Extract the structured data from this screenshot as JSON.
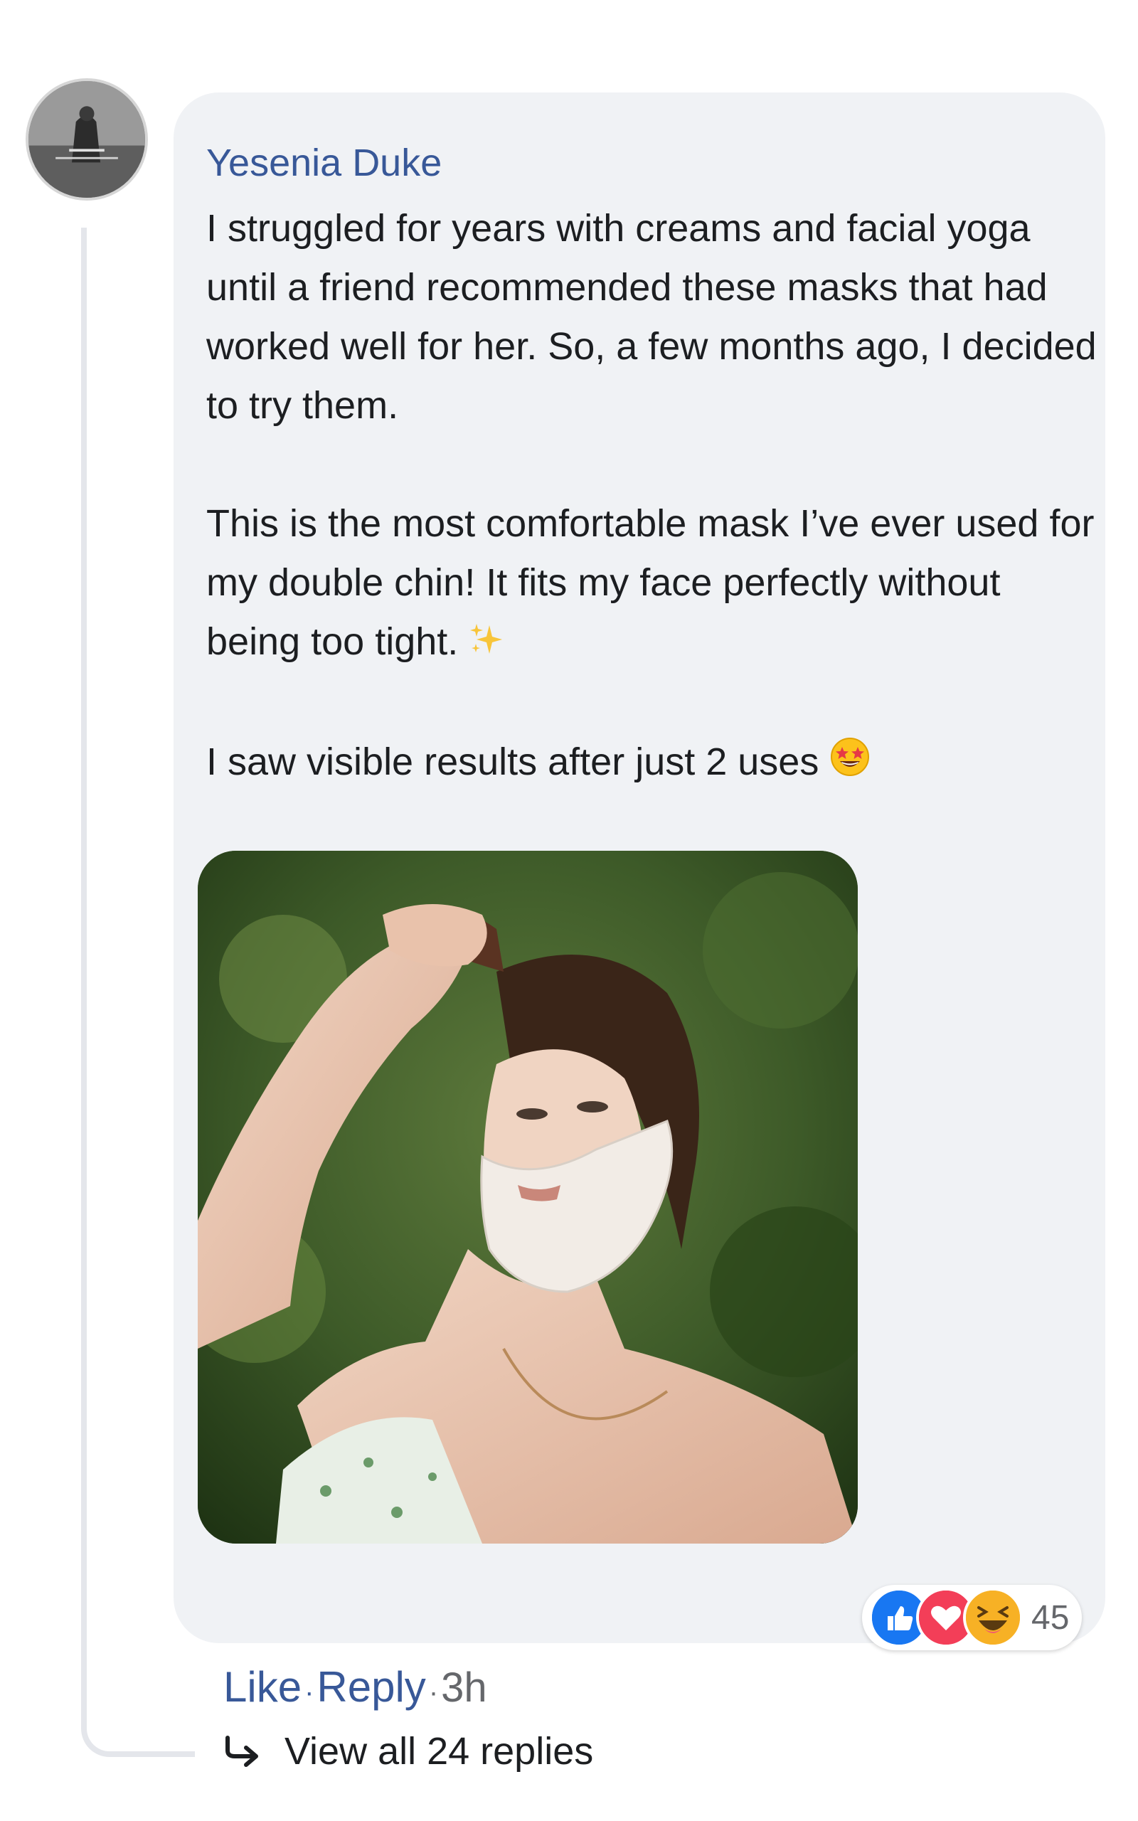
{
  "comment": {
    "author": "Yesenia Duke",
    "paragraphs": [
      "I struggled for years with creams and facial yoga until a friend recommended these masks that had worked well for her. So, a few months ago, I decided to try them.",
      "This is the most comfortable mask I’ve ever used for my double chin! It fits my face perfectly without being too tight.",
      "I saw visible results after just 2 uses"
    ],
    "paragraph_emojis": [
      "",
      "sparkles-emoji",
      "star-struck-emoji"
    ],
    "photo_icon": "woman-wearing-chin-mask-photo"
  },
  "reactions": {
    "icons": [
      "like-icon",
      "love-icon",
      "haha-icon"
    ],
    "count": "45"
  },
  "actions": {
    "like": "Like",
    "separator": "·",
    "reply": "Reply",
    "time": "3h"
  },
  "replies": {
    "label": "View all 24 replies",
    "icon": "reply-arrow-icon"
  },
  "colors": {
    "name_link": "#385898",
    "bubble_bg": "#f0f2f5",
    "meta_gray": "#65676b",
    "like_blue": "#1877f2",
    "love_red": "#f33e58",
    "haha_yellow": "#f7b125"
  }
}
